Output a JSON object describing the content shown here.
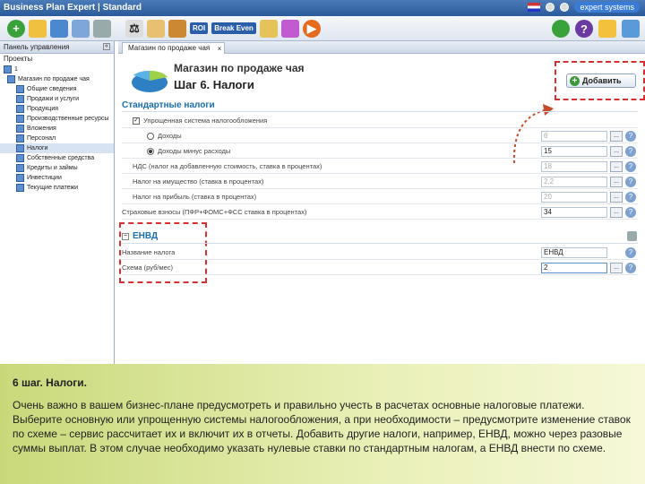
{
  "app": {
    "title": "Business Plan Expert | Standard",
    "brand": "expert systems"
  },
  "toolbar": {
    "roi_label": "ROI",
    "break_even_label": "Break Even"
  },
  "left_panel": {
    "title": "Панель управления",
    "projects_label": "Проекты",
    "items": [
      {
        "label": "1"
      },
      {
        "label": "Магазин по продаже чая"
      },
      {
        "label": "Общие сведения"
      },
      {
        "label": "Продажи и услуги"
      },
      {
        "label": "Продукция"
      },
      {
        "label": "Производственные ресурсы"
      },
      {
        "label": "Вложения"
      },
      {
        "label": "Персонал"
      },
      {
        "label": "Налоги"
      },
      {
        "label": "Собственные средства"
      },
      {
        "label": "Кредиты и займы"
      },
      {
        "label": "Инвестиции"
      },
      {
        "label": "Текущие платежи"
      }
    ]
  },
  "tab": {
    "label": "Магазин по продаже чая"
  },
  "header": {
    "title": "Магазин по продаже чая",
    "step": "Шаг 6. Налоги",
    "add_button": "Добавить"
  },
  "standard_taxes": {
    "section_title": "Стандартные налоги",
    "rows": [
      {
        "label": "Упрощенная система налогообложения",
        "value": "",
        "type": "checkbox"
      },
      {
        "label": "Доходы",
        "value": "6",
        "type": "radio"
      },
      {
        "label": "Доходы минус расходы",
        "value": "15",
        "type": "radio"
      },
      {
        "label": "НДС (налог на добавленную стоимость, ставка в процентах)",
        "value": "18",
        "type": "text"
      },
      {
        "label": "Налог на имущество (ставка в процентах)",
        "value": "2,2",
        "type": "text"
      },
      {
        "label": "Налог на прибыль (ставка в процентах)",
        "value": "20",
        "type": "text"
      },
      {
        "label": "Страховые взносы (ПФР+ФОМС+ФСС ставка в процентах)",
        "value": "34",
        "type": "text"
      }
    ]
  },
  "envd": {
    "section_title": "ЕНВД",
    "rows": [
      {
        "label": "Название налога",
        "value": "ЕНВД"
      },
      {
        "label": "Схема (руб/мес)",
        "value": "2"
      }
    ]
  },
  "caption": {
    "title": "6 шаг. Налоги.",
    "text": "Очень важно в вашем бизнес-плане предусмотреть и правильно учесть в расчетах основные налоговые платежи. Выберите основную или упрощенную системы налогообложения, а при необходимости – предусмотрите изменение ставок по схеме – сервис рассчитает их и включит их в отчеты. Добавить другие налоги, например, ЕНВД, можно через разовые суммы выплат. В этом случае необходимо указать нулевые ставки по стандартным налогам, а ЕНВД внести по схеме."
  }
}
